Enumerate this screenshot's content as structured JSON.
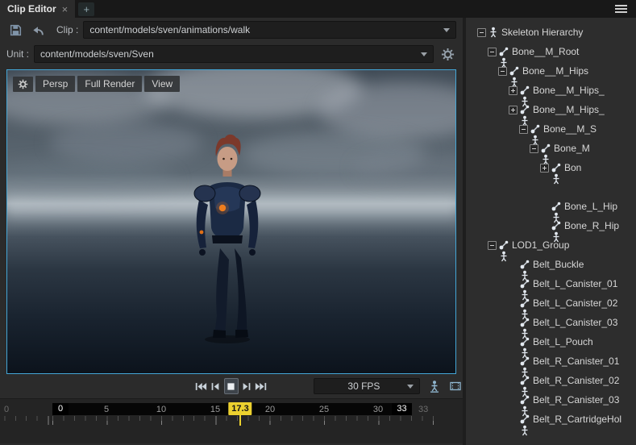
{
  "window": {
    "tabs": [
      {
        "label": "Clip Editor",
        "close_label": "×"
      }
    ],
    "new_tab_label": "+"
  },
  "toolbar": {
    "clip_label": "Clip :",
    "clip_value": "content/models/sven/animations/walk",
    "unit_label": "Unit :",
    "unit_value": "content/models/sven/Sven"
  },
  "viewport": {
    "buttons": {
      "persp": "Persp",
      "full_render": "Full Render",
      "view": "View"
    }
  },
  "playback": {
    "fps_value": "30 FPS",
    "transport_icons": [
      "skip-to-start",
      "step-back",
      "stop",
      "step-forward",
      "skip-to-end"
    ],
    "toggle_icons": [
      "character-pose",
      "camera-film"
    ]
  },
  "timeline": {
    "outer_start_label": "0",
    "range_start_label": "0",
    "tick_labels": [
      "5",
      "10",
      "15",
      "20",
      "25",
      "30"
    ],
    "playhead_label": "17.3",
    "range_end_label": "33",
    "outer_end_label": "33",
    "clip_start": 0,
    "clip_end": 33,
    "current_frame": 17.3,
    "fps": 30
  },
  "hierarchy": {
    "items": [
      {
        "label": "Skeleton Hierarchy",
        "depth": 0,
        "expander": "minus",
        "icon": "skeleton"
      },
      {
        "label": "Bone__M_Root",
        "depth": 1,
        "expander": "minus",
        "icon": "bone"
      },
      {
        "label": "Bone__M_Hips",
        "depth": 2,
        "expander": "minus",
        "icon": "bone"
      },
      {
        "label": "Bone__M_Hips_",
        "depth": 3,
        "expander": "plus",
        "icon": "bone"
      },
      {
        "label": "Bone__M_Hips_",
        "depth": 3,
        "expander": "plus",
        "icon": "bone"
      },
      {
        "label": "Bone__M_S",
        "depth": 4,
        "expander": "minus",
        "icon": "bone"
      },
      {
        "label": "Bone_M",
        "depth": 5,
        "expander": "minus",
        "icon": "bone"
      },
      {
        "label": "Bon",
        "depth": 6,
        "expander": "plus",
        "icon": "bone"
      },
      {
        "label": "",
        "depth": 7,
        "expander": "none",
        "icon": "none"
      },
      {
        "label": "Bone_L_Hip",
        "depth": 6,
        "expander": "none",
        "icon": "bone"
      },
      {
        "label": "Bone_R_Hip",
        "depth": 6,
        "expander": "none",
        "icon": "bone"
      },
      {
        "label": "LOD1_Group",
        "depth": 1,
        "expander": "minus",
        "icon": "bone"
      },
      {
        "label": "Belt_Buckle",
        "depth": 3,
        "expander": "none",
        "icon": "bone"
      },
      {
        "label": "Belt_L_Canister_01",
        "depth": 3,
        "expander": "none",
        "icon": "bone"
      },
      {
        "label": "Belt_L_Canister_02",
        "depth": 3,
        "expander": "none",
        "icon": "bone"
      },
      {
        "label": "Belt_L_Canister_03",
        "depth": 3,
        "expander": "none",
        "icon": "bone"
      },
      {
        "label": "Belt_L_Pouch",
        "depth": 3,
        "expander": "none",
        "icon": "bone"
      },
      {
        "label": "Belt_R_Canister_01",
        "depth": 3,
        "expander": "none",
        "icon": "bone"
      },
      {
        "label": "Belt_R_Canister_02",
        "depth": 3,
        "expander": "none",
        "icon": "bone"
      },
      {
        "label": "Belt_R_Canister_03",
        "depth": 3,
        "expander": "none",
        "icon": "bone"
      },
      {
        "label": "Belt_R_CartridgeHol",
        "depth": 3,
        "expander": "none",
        "icon": "bone"
      }
    ]
  },
  "colors": {
    "viewport_border": "#44a6d6",
    "playhead_yellow": "#ecd12f",
    "background": "#2b2b2b",
    "tab_bar": "#181818",
    "field": "#1e1e1e"
  },
  "icons": {
    "toolbar": [
      "save-floppy",
      "undo-arrow",
      "gear",
      "chevron-down"
    ],
    "tabbar": [
      "close-x",
      "plus",
      "hamburger-menu"
    ],
    "tree": [
      "skeleton",
      "bone",
      "expander-plus",
      "expander-minus"
    ]
  }
}
